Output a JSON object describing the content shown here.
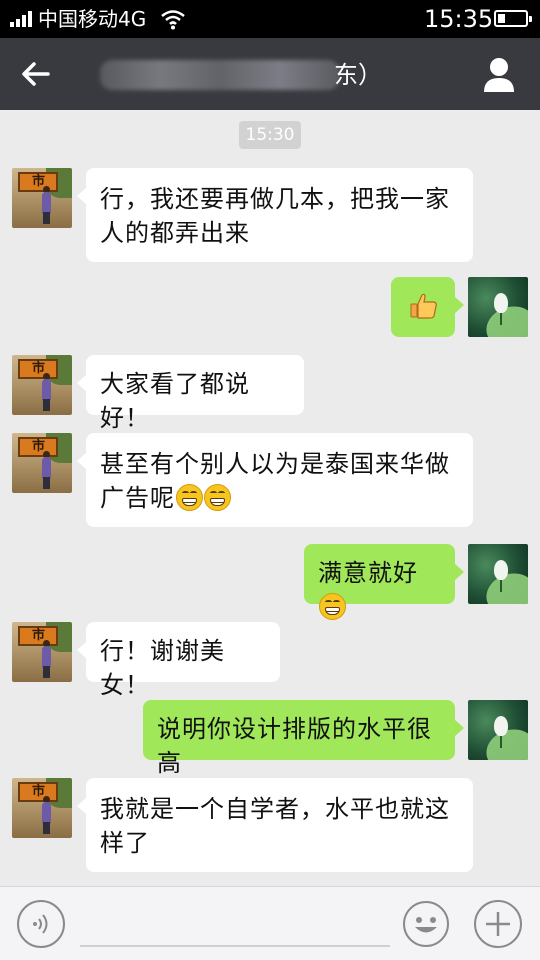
{
  "status_bar": {
    "carrier": "中国移动4G",
    "time": "15:35",
    "battery_level": 0.25
  },
  "header": {
    "contact_name_visible": "东）",
    "back_icon": "arrow-left-icon",
    "profile_icon": "person-icon"
  },
  "chat": {
    "timestamp": "15:30",
    "messages": [
      {
        "side": "in",
        "text": "行，我还要再做几本，把我一家人的都弄出来"
      },
      {
        "side": "out",
        "text": "",
        "emoji": "thumbs-up-icon"
      },
      {
        "side": "in",
        "text": "大家看了都说好！"
      },
      {
        "side": "in",
        "text": "甚至有个别人以为是泰国来华做广告呢",
        "emoji_count": 2
      },
      {
        "side": "out",
        "text": "满意就好",
        "emoji_count": 1
      },
      {
        "side": "in",
        "text": "行！谢谢美女！"
      },
      {
        "side": "out",
        "text": "说明你设计排版的水平很高"
      },
      {
        "side": "in",
        "text": "我就是一个自学者，水平也就这样了"
      }
    ]
  },
  "input_bar": {
    "voice_icon": "voice-icon",
    "emoji_icon": "smiley-icon",
    "plus_icon": "plus-icon"
  },
  "colors": {
    "title_bar": "#393a3f",
    "chat_bg": "#ebebeb",
    "bubble_out": "#a0e75a",
    "bubble_in": "#ffffff"
  }
}
